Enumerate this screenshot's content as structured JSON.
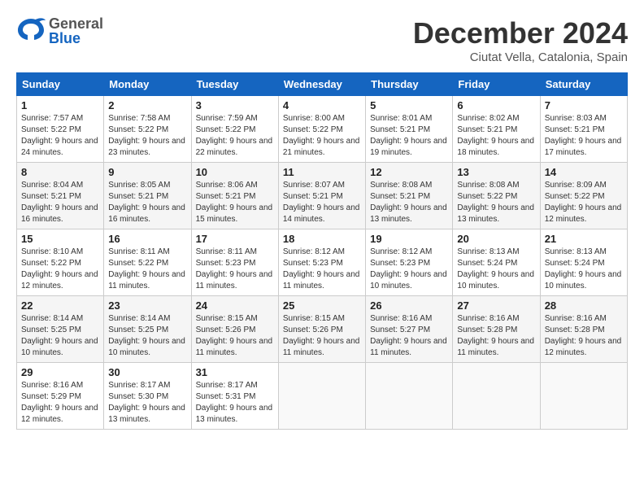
{
  "header": {
    "logo_general": "General",
    "logo_blue": "Blue",
    "main_title": "December 2024",
    "subtitle": "Ciutat Vella, Catalonia, Spain"
  },
  "calendar": {
    "columns": [
      "Sunday",
      "Monday",
      "Tuesday",
      "Wednesday",
      "Thursday",
      "Friday",
      "Saturday"
    ],
    "weeks": [
      [
        {
          "day": "1",
          "sunrise": "Sunrise: 7:57 AM",
          "sunset": "Sunset: 5:22 PM",
          "daylight": "Daylight: 9 hours and 24 minutes."
        },
        {
          "day": "2",
          "sunrise": "Sunrise: 7:58 AM",
          "sunset": "Sunset: 5:22 PM",
          "daylight": "Daylight: 9 hours and 23 minutes."
        },
        {
          "day": "3",
          "sunrise": "Sunrise: 7:59 AM",
          "sunset": "Sunset: 5:22 PM",
          "daylight": "Daylight: 9 hours and 22 minutes."
        },
        {
          "day": "4",
          "sunrise": "Sunrise: 8:00 AM",
          "sunset": "Sunset: 5:22 PM",
          "daylight": "Daylight: 9 hours and 21 minutes."
        },
        {
          "day": "5",
          "sunrise": "Sunrise: 8:01 AM",
          "sunset": "Sunset: 5:21 PM",
          "daylight": "Daylight: 9 hours and 19 minutes."
        },
        {
          "day": "6",
          "sunrise": "Sunrise: 8:02 AM",
          "sunset": "Sunset: 5:21 PM",
          "daylight": "Daylight: 9 hours and 18 minutes."
        },
        {
          "day": "7",
          "sunrise": "Sunrise: 8:03 AM",
          "sunset": "Sunset: 5:21 PM",
          "daylight": "Daylight: 9 hours and 17 minutes."
        }
      ],
      [
        {
          "day": "8",
          "sunrise": "Sunrise: 8:04 AM",
          "sunset": "Sunset: 5:21 PM",
          "daylight": "Daylight: 9 hours and 16 minutes."
        },
        {
          "day": "9",
          "sunrise": "Sunrise: 8:05 AM",
          "sunset": "Sunset: 5:21 PM",
          "daylight": "Daylight: 9 hours and 16 minutes."
        },
        {
          "day": "10",
          "sunrise": "Sunrise: 8:06 AM",
          "sunset": "Sunset: 5:21 PM",
          "daylight": "Daylight: 9 hours and 15 minutes."
        },
        {
          "day": "11",
          "sunrise": "Sunrise: 8:07 AM",
          "sunset": "Sunset: 5:21 PM",
          "daylight": "Daylight: 9 hours and 14 minutes."
        },
        {
          "day": "12",
          "sunrise": "Sunrise: 8:08 AM",
          "sunset": "Sunset: 5:21 PM",
          "daylight": "Daylight: 9 hours and 13 minutes."
        },
        {
          "day": "13",
          "sunrise": "Sunrise: 8:08 AM",
          "sunset": "Sunset: 5:22 PM",
          "daylight": "Daylight: 9 hours and 13 minutes."
        },
        {
          "day": "14",
          "sunrise": "Sunrise: 8:09 AM",
          "sunset": "Sunset: 5:22 PM",
          "daylight": "Daylight: 9 hours and 12 minutes."
        }
      ],
      [
        {
          "day": "15",
          "sunrise": "Sunrise: 8:10 AM",
          "sunset": "Sunset: 5:22 PM",
          "daylight": "Daylight: 9 hours and 12 minutes."
        },
        {
          "day": "16",
          "sunrise": "Sunrise: 8:11 AM",
          "sunset": "Sunset: 5:22 PM",
          "daylight": "Daylight: 9 hours and 11 minutes."
        },
        {
          "day": "17",
          "sunrise": "Sunrise: 8:11 AM",
          "sunset": "Sunset: 5:23 PM",
          "daylight": "Daylight: 9 hours and 11 minutes."
        },
        {
          "day": "18",
          "sunrise": "Sunrise: 8:12 AM",
          "sunset": "Sunset: 5:23 PM",
          "daylight": "Daylight: 9 hours and 11 minutes."
        },
        {
          "day": "19",
          "sunrise": "Sunrise: 8:12 AM",
          "sunset": "Sunset: 5:23 PM",
          "daylight": "Daylight: 9 hours and 10 minutes."
        },
        {
          "day": "20",
          "sunrise": "Sunrise: 8:13 AM",
          "sunset": "Sunset: 5:24 PM",
          "daylight": "Daylight: 9 hours and 10 minutes."
        },
        {
          "day": "21",
          "sunrise": "Sunrise: 8:13 AM",
          "sunset": "Sunset: 5:24 PM",
          "daylight": "Daylight: 9 hours and 10 minutes."
        }
      ],
      [
        {
          "day": "22",
          "sunrise": "Sunrise: 8:14 AM",
          "sunset": "Sunset: 5:25 PM",
          "daylight": "Daylight: 9 hours and 10 minutes."
        },
        {
          "day": "23",
          "sunrise": "Sunrise: 8:14 AM",
          "sunset": "Sunset: 5:25 PM",
          "daylight": "Daylight: 9 hours and 10 minutes."
        },
        {
          "day": "24",
          "sunrise": "Sunrise: 8:15 AM",
          "sunset": "Sunset: 5:26 PM",
          "daylight": "Daylight: 9 hours and 11 minutes."
        },
        {
          "day": "25",
          "sunrise": "Sunrise: 8:15 AM",
          "sunset": "Sunset: 5:26 PM",
          "daylight": "Daylight: 9 hours and 11 minutes."
        },
        {
          "day": "26",
          "sunrise": "Sunrise: 8:16 AM",
          "sunset": "Sunset: 5:27 PM",
          "daylight": "Daylight: 9 hours and 11 minutes."
        },
        {
          "day": "27",
          "sunrise": "Sunrise: 8:16 AM",
          "sunset": "Sunset: 5:28 PM",
          "daylight": "Daylight: 9 hours and 11 minutes."
        },
        {
          "day": "28",
          "sunrise": "Sunrise: 8:16 AM",
          "sunset": "Sunset: 5:28 PM",
          "daylight": "Daylight: 9 hours and 12 minutes."
        }
      ],
      [
        {
          "day": "29",
          "sunrise": "Sunrise: 8:16 AM",
          "sunset": "Sunset: 5:29 PM",
          "daylight": "Daylight: 9 hours and 12 minutes."
        },
        {
          "day": "30",
          "sunrise": "Sunrise: 8:17 AM",
          "sunset": "Sunset: 5:30 PM",
          "daylight": "Daylight: 9 hours and 13 minutes."
        },
        {
          "day": "31",
          "sunrise": "Sunrise: 8:17 AM",
          "sunset": "Sunset: 5:31 PM",
          "daylight": "Daylight: 9 hours and 13 minutes."
        },
        null,
        null,
        null,
        null
      ]
    ]
  }
}
